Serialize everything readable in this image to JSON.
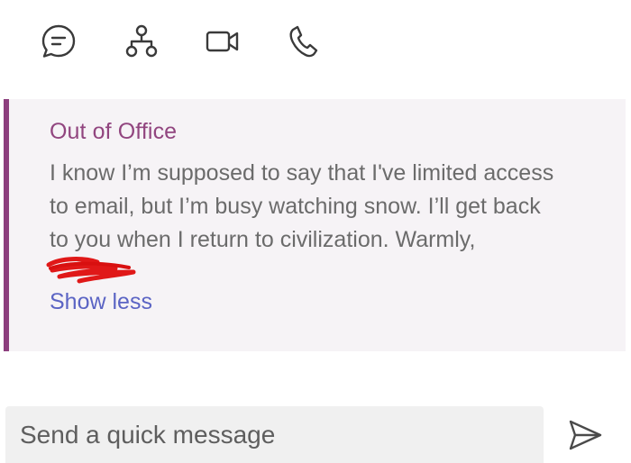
{
  "toolbar": {
    "icons": [
      "chat-icon",
      "org-chart-icon",
      "video-call-icon",
      "phone-icon"
    ]
  },
  "ooo": {
    "title": "Out of Office",
    "lines": [
      "I know I’m supposed to say that I've limited access",
      "to email, but I’m busy watching snow. I’ll get back",
      "to you when I return to civilization. Warmly,"
    ],
    "show_less": "Show less"
  },
  "composer": {
    "placeholder": "Send a quick message",
    "value": ""
  },
  "colors": {
    "accent": "#8d3f7e",
    "title": "#91457f",
    "link": "#5b64c4",
    "card_bg": "#f6f3f6",
    "redaction": "#e01818"
  }
}
